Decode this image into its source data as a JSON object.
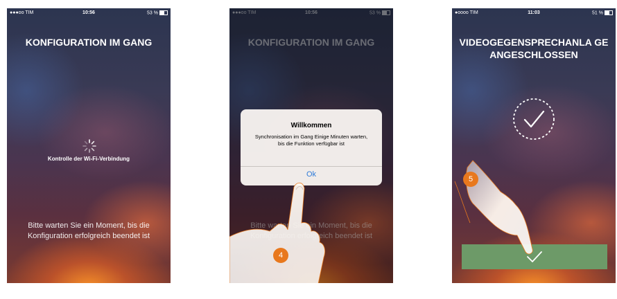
{
  "screens": [
    {
      "status": {
        "carrier": "●●●oo TIM",
        "time": "10:56",
        "battery": "53 %"
      },
      "title": "KONFIGURATION IM GANG",
      "wifi_label": "Kontrolle der Wi-Fi-Verbindung",
      "wait_text": "Bitte warten Sie ein Moment, bis die Konfiguration erfolgreich beendet ist"
    },
    {
      "status": {
        "carrier": "●●●oo TIM",
        "time": "10:56",
        "battery": "53 %"
      },
      "title": "KONFIGURATION IM GANG",
      "wait_text": "Bitte warten Sie ein Moment, bis die Konfiguration erfolgreich beendet ist",
      "dialog": {
        "title": "Willkommen",
        "message": "Synchronisation im Gang Einige Minuten warten, bis die Funktion verfügbar ist",
        "ok_label": "Ok"
      },
      "step_badge": "4"
    },
    {
      "status": {
        "carrier": "●oooo TIM",
        "time": "11:03",
        "battery": "51 %"
      },
      "title": "VIDEOGEGENSPRECHANLA GE ANGESCHLOSSEN",
      "step_badge": "5"
    }
  ],
  "colors": {
    "badge": "#e8781d",
    "confirm_bar": "#6d9a68",
    "ok_link": "#2f7bd8"
  }
}
